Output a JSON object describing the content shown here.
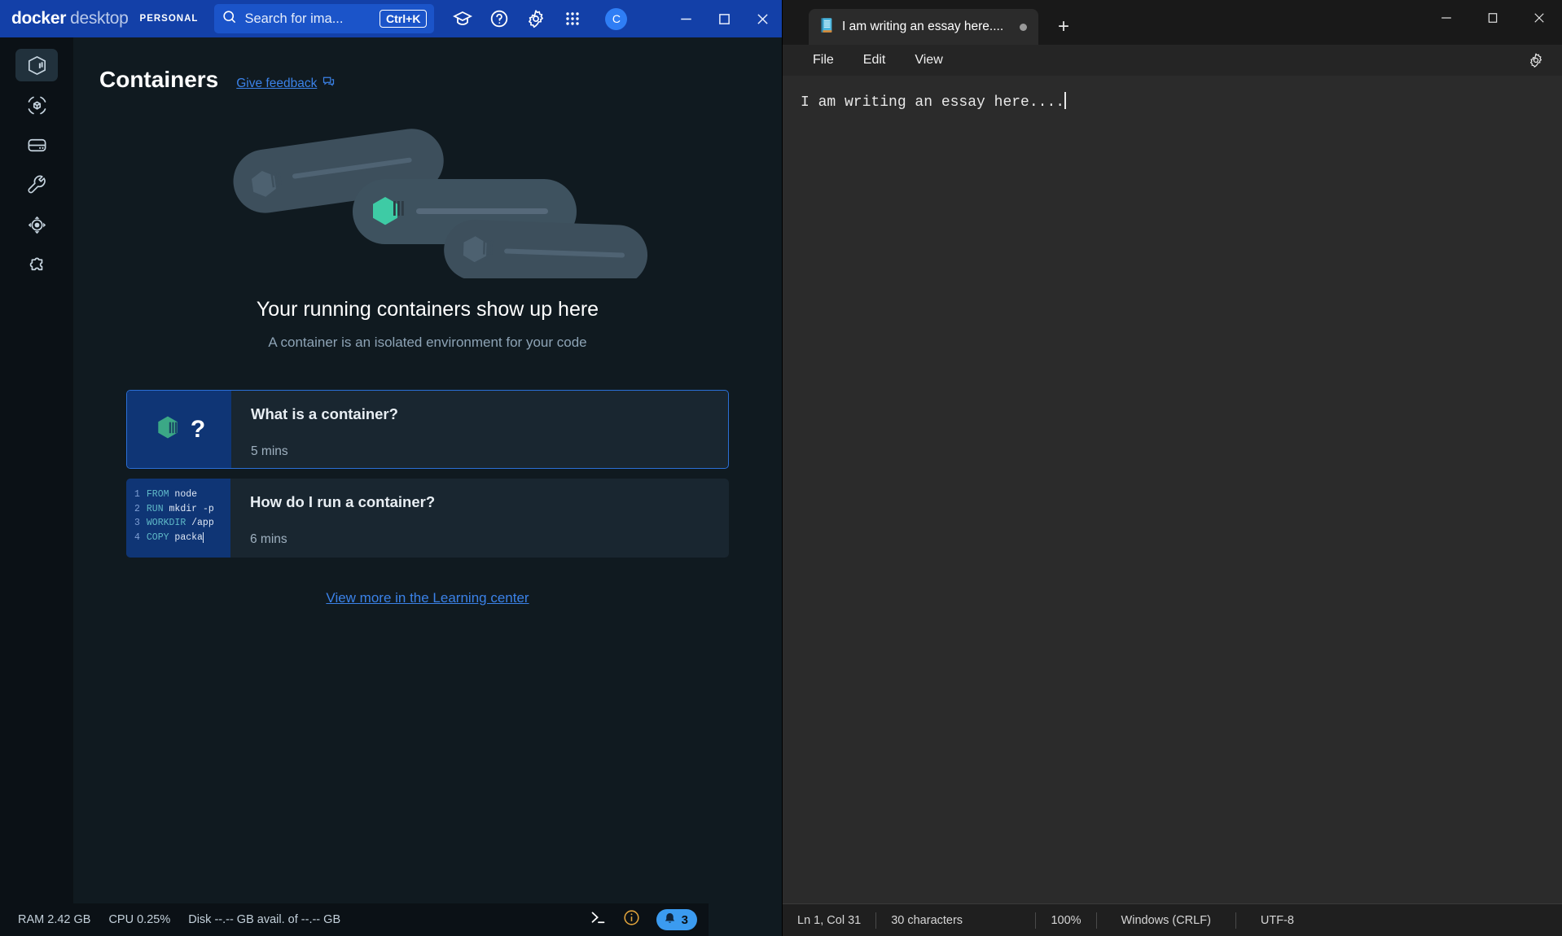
{
  "docker": {
    "titlebar": {
      "brand_bold": "docker",
      "brand_light": "desktop",
      "plan_badge": "PERSONAL",
      "search_placeholder": "Search for ima...",
      "search_shortcut": "Ctrl+K",
      "icons": [
        "learning-center-icon",
        "help-icon",
        "settings-gear-icon",
        "apps-grid-icon"
      ],
      "avatar_letter": "C",
      "accent_color": "#1340a8"
    },
    "sidebar": {
      "items": [
        {
          "name": "containers",
          "label": "Containers",
          "active": true
        },
        {
          "name": "images",
          "label": "Images",
          "active": false
        },
        {
          "name": "volumes",
          "label": "Volumes",
          "active": false
        },
        {
          "name": "builds",
          "label": "Builds",
          "active": false
        },
        {
          "name": "docker-scout",
          "label": "Docker Scout",
          "active": false
        },
        {
          "name": "extensions",
          "label": "Extensions",
          "active": false
        }
      ]
    },
    "page": {
      "title": "Containers",
      "feedback_link": "Give feedback",
      "empty_title": "Your running containers show up here",
      "empty_subtitle": "A container is an isolated environment for your code",
      "learning_link": "View more in the Learning center"
    },
    "cards": [
      {
        "title": "What is a container?",
        "duration": "5 mins",
        "art": "container-question"
      },
      {
        "title": "How do I run a container?",
        "duration": "6 mins",
        "art": "dockerfile-code"
      }
    ],
    "code_snippet": [
      {
        "num": "1",
        "kw": "FROM",
        "rest": "node"
      },
      {
        "num": "2",
        "kw": "RUN",
        "rest": "mkdir -p"
      },
      {
        "num": "3",
        "kw": "WORKDIR",
        "rest": "/app"
      },
      {
        "num": "4",
        "kw": "COPY",
        "rest": "packa"
      }
    ],
    "statusbar": {
      "ram": "RAM 2.42 GB",
      "cpu": "CPU 0.25%",
      "disk": "Disk --.-- GB avail. of --.-- GB",
      "notification_count": "3"
    }
  },
  "notepad": {
    "tab": {
      "title": "I am writing an essay here....",
      "unsaved": true,
      "new_tab_label": "+"
    },
    "menus": [
      "File",
      "Edit",
      "View"
    ],
    "document_text": "I am writing an essay here....",
    "statusbar": {
      "cursor": "Ln 1, Col 31",
      "characters": "30 characters",
      "zoom": "100%",
      "line_endings": "Windows (CRLF)",
      "encoding": "UTF-8"
    }
  }
}
